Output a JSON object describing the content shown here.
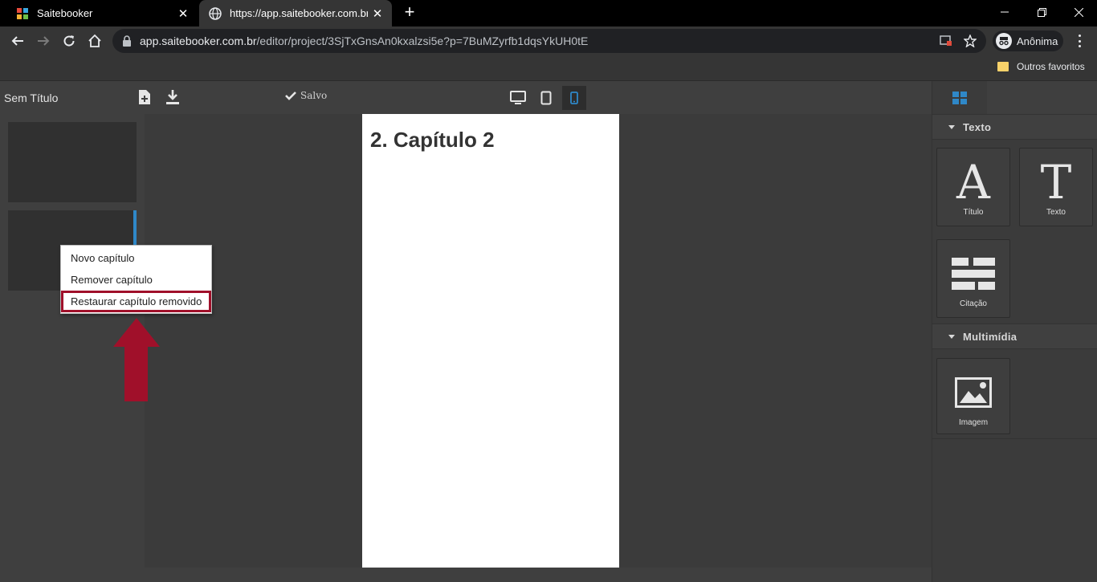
{
  "browser": {
    "tabs": [
      {
        "title": "Saitebooker",
        "active": false
      },
      {
        "title": "https://app.saitebooker.com.br/e",
        "active": true
      }
    ],
    "url": {
      "host": "app.saitebooker.com.br",
      "path": "/editor/project/3SjTxGnsAn0kxalzsi5e?p=7BuMZyrfb1dqsYkUH0tE"
    },
    "profile_label": "Anônima",
    "bookmarks": [
      {
        "label": "Outros favoritos"
      }
    ]
  },
  "editor": {
    "doc_title": "Sem Título",
    "save_status": "Salvo",
    "page_heading": "2. Capítulo 2"
  },
  "context_menu": {
    "items": [
      {
        "label": "Novo capítulo"
      },
      {
        "label": "Remover capítulo"
      },
      {
        "label": "Restaurar capítulo removido",
        "highlighted": true
      }
    ]
  },
  "right_panel": {
    "sections": [
      {
        "title": "Texto",
        "blocks": [
          {
            "glyph": "A",
            "label": "Título"
          },
          {
            "glyph": "T",
            "label": "Texto"
          },
          {
            "label": "Citação"
          }
        ]
      },
      {
        "title": "Multimídia",
        "blocks": [
          {
            "label": "Imagem"
          }
        ]
      }
    ]
  },
  "colors": {
    "accent_blue": "#2f88c8",
    "annotation_red": "#a0102a"
  }
}
